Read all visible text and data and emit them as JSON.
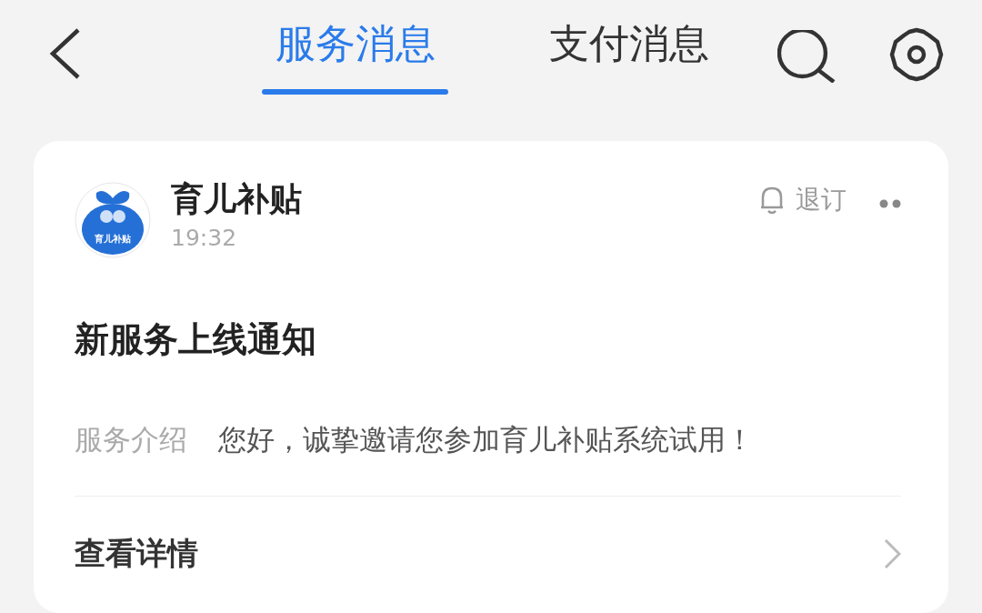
{
  "header": {
    "tabs": [
      {
        "label": "服务消息",
        "selected": true
      },
      {
        "label": "支付消息",
        "selected": false
      }
    ]
  },
  "message": {
    "sender": "育儿补贴",
    "logo_text": "育儿补贴",
    "time": "19:32",
    "unsubscribe": "退订",
    "title": "新服务上线通知",
    "fields": [
      {
        "label": "服务介绍",
        "value": "您好，诚挚邀请您参加育儿补贴系统试用！"
      }
    ],
    "action": "查看详情"
  }
}
